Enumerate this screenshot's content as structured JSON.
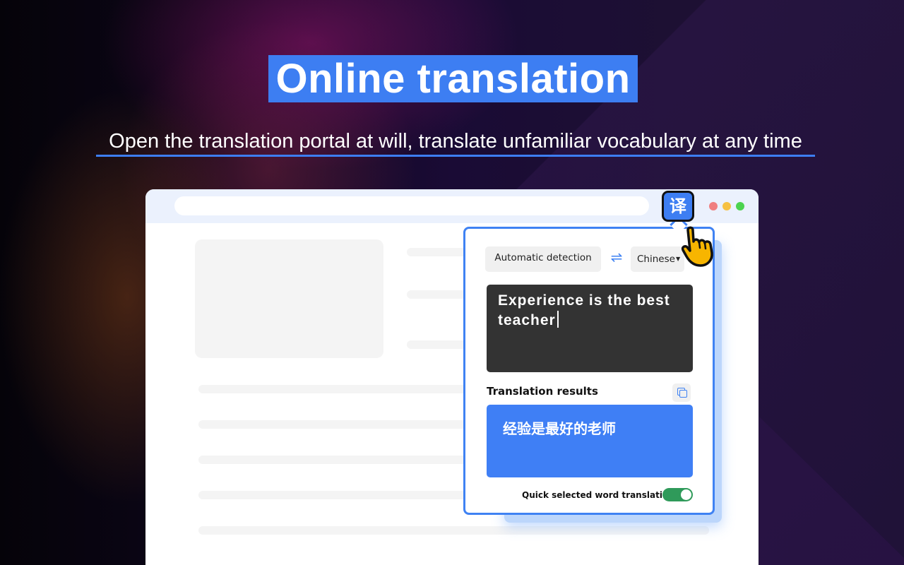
{
  "banner": {
    "title": "Online translation",
    "subtitle": "Open the translation portal at will, translate unfamiliar vocabulary at any time"
  },
  "browser": {
    "extension_button_label": "译",
    "window_controls": [
      "close",
      "minimize",
      "maximize"
    ]
  },
  "popup": {
    "source_language": "Automatic detection",
    "swap_icon": "swap-arrows-icon",
    "target_language": "Chinese",
    "source_text": "Experience is the best teacher",
    "results_title": "Translation results",
    "copy_icon": "copy-icon",
    "result_text": "经验是最好的老师",
    "quick_translation_label": "Quick selected word translation",
    "quick_translation_enabled": true
  },
  "colors": {
    "accent": "#3d7ef2",
    "toggle_on": "#2f9a5a",
    "source_box": "#333333"
  }
}
